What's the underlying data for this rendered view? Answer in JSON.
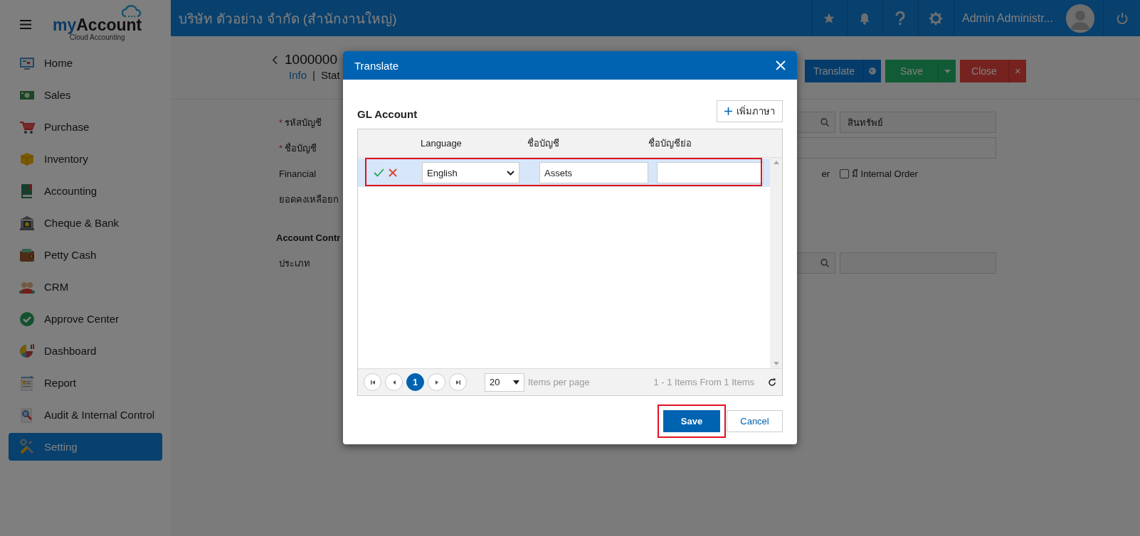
{
  "logo": {
    "first": "my",
    "second": "Account",
    "tagline": "Cloud Accounting"
  },
  "header": {
    "company": "บริษัท ตัวอย่าง จำกัด (สำนักงานใหญ่)",
    "user": "Admin Administr..."
  },
  "sidebar": {
    "items": [
      {
        "label": "Home",
        "selected": false
      },
      {
        "label": "Sales",
        "selected": false
      },
      {
        "label": "Purchase",
        "selected": false
      },
      {
        "label": "Inventory",
        "selected": false
      },
      {
        "label": "Accounting",
        "selected": false
      },
      {
        "label": "Cheque & Bank",
        "selected": false
      },
      {
        "label": "Petty Cash",
        "selected": false
      },
      {
        "label": "CRM",
        "selected": false
      },
      {
        "label": "Approve Center",
        "selected": false
      },
      {
        "label": "Dashboard",
        "selected": false
      },
      {
        "label": "Report",
        "selected": false
      },
      {
        "label": "Audit & Internal Control",
        "selected": false
      },
      {
        "label": "Setting",
        "selected": true
      }
    ]
  },
  "record": {
    "title": "1000000",
    "tabs": [
      {
        "label": "Info",
        "selected": false
      },
      {
        "label": "Stat",
        "selected": true
      }
    ],
    "separator": "|"
  },
  "toolbar": {
    "translate": "Translate",
    "save": "Save",
    "close": "Close",
    "close_mark": "×"
  },
  "form": {
    "code": {
      "marker": "*",
      "label": "รหัสบัญชี",
      "type_value": "สินทรัพย์"
    },
    "name": {
      "marker": "*",
      "label": "ชื่อบัญชี"
    },
    "financial": {
      "label": "Financial",
      "option_fragment": "er",
      "internal_order": {
        "label": "มี Internal Order",
        "checked": false
      }
    },
    "balance": {
      "label": "ยอดคงเหลือยก"
    },
    "section": "Account Contr",
    "category": {
      "label": "ประเภท"
    }
  },
  "dialog": {
    "title": "Translate",
    "heading": "GL Account",
    "add_button": "เพิ่มภาษา",
    "columns": [
      "Language",
      "ชื่อบัญชี",
      "ชื่อบัญชีย่อ"
    ],
    "rows": [
      {
        "language": "English",
        "name": "Assets"
      }
    ],
    "pager": {
      "pages": [
        {
          "label": "1",
          "selected": true
        }
      ],
      "page_size": "20",
      "page_size_label": "Items per page",
      "summary": "1 - 1 Items From 1 Items"
    },
    "save": "Save",
    "cancel": "Cancel"
  }
}
